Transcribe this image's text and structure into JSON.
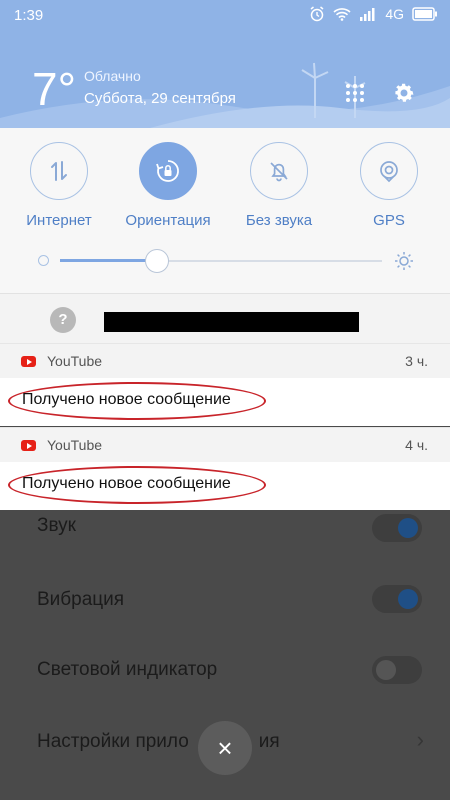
{
  "status": {
    "time": "1:39",
    "network": "4G"
  },
  "weather": {
    "temp": "7°",
    "condition": "Облачно",
    "date": "Суббота, 29 сентября"
  },
  "quick_settings": [
    {
      "label": "Интернет",
      "icon": "data-arrows-icon",
      "active": false
    },
    {
      "label": "Ориентация",
      "icon": "rotation-lock-icon",
      "active": true
    },
    {
      "label": "Без звука",
      "icon": "bell-off-icon",
      "active": false
    },
    {
      "label": "GPS",
      "icon": "location-icon",
      "active": false
    }
  ],
  "brightness": {
    "level": 0.3
  },
  "notifications": [
    {
      "app": "YouTube",
      "time": "3 ч.",
      "text": "Получено новое сообщение"
    },
    {
      "app": "YouTube",
      "time": "4 ч.",
      "text": "Получено новое сообщение"
    }
  ],
  "settings_list": [
    {
      "label": "Звук"
    },
    {
      "label": "Вибрация"
    },
    {
      "label": "Световой индикатор"
    },
    {
      "label": "Настройки прило",
      "hidden_tail": "ия"
    }
  ],
  "close_label": "×",
  "help_label": "?"
}
